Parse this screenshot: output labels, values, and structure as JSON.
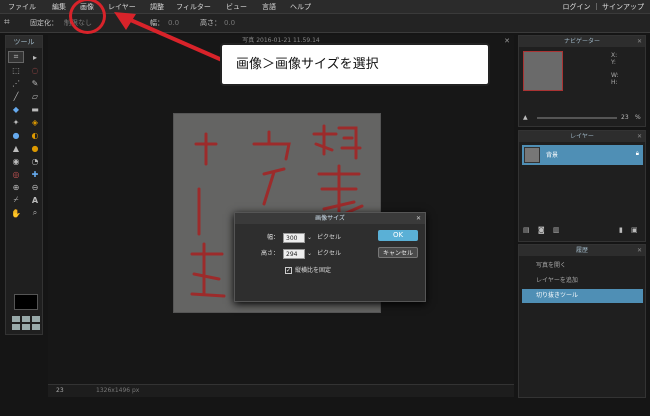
{
  "menu": {
    "items": [
      "ファイル",
      "編集",
      "画像",
      "レイヤー",
      "調整",
      "フィルター",
      "ビュー",
      "言語",
      "ヘルプ"
    ],
    "auth": "ログイン ｜ サインアップ"
  },
  "options": {
    "fixed_label": "固定化：",
    "fixed_value": "制限なし",
    "width_label": "幅：",
    "width_value": "0.0",
    "height_label": "高さ：",
    "height_value": "0.0"
  },
  "tools": {
    "header": "ツール"
  },
  "document": {
    "title": "写真 2016-01-21 11.59.14",
    "zoom": "23",
    "dimensions": "1326x1496 px"
  },
  "navigator": {
    "header": "ナビゲーター",
    "coords": [
      "X:",
      "Y:",
      "W:",
      "H:"
    ],
    "zoom": "23",
    "zoom_unit": "%"
  },
  "layers": {
    "header": "レイヤー",
    "items": [
      "背景"
    ]
  },
  "history": {
    "header": "履歴",
    "items": [
      "写真を開く",
      "レイヤーを追加",
      "切り抜きツール"
    ]
  },
  "dialog": {
    "title": "画像サイズ",
    "width_label": "幅：",
    "width_value": "300",
    "height_label": "高さ：",
    "height_value": "294",
    "unit": "ピクセル",
    "ok": "OK",
    "cancel": "キャンセル",
    "constrain": "縦横比を固定"
  },
  "annotation": {
    "text": "画像＞画像サイズを選択"
  },
  "colors": {
    "accent": "#5ab0d6",
    "selection": "#4f8fb5",
    "annotation": "#d8232a"
  }
}
